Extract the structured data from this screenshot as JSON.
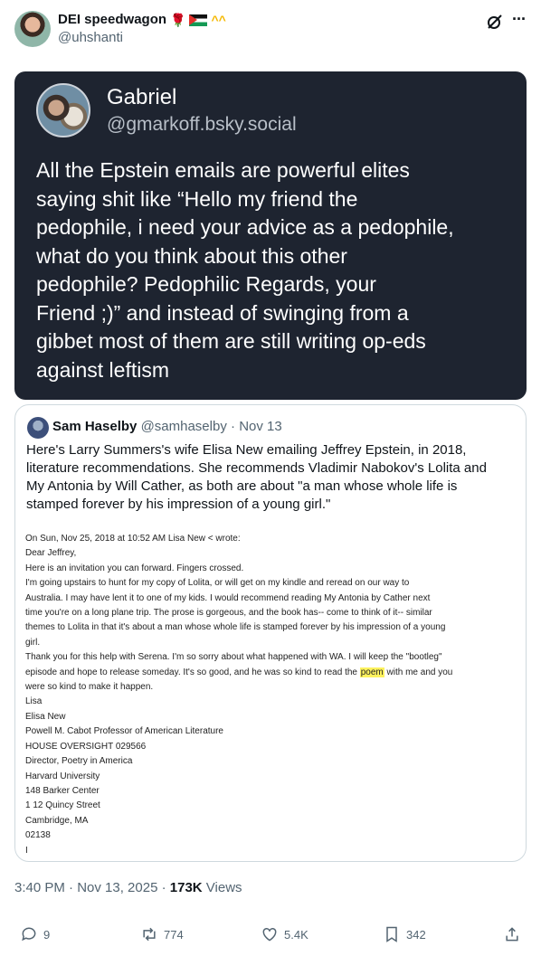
{
  "tweet": {
    "author_name": "DEI speedwagon",
    "author_handle": "@uhshanti"
  },
  "image_post": {
    "name": "Gabriel",
    "handle": "@gmarkoff.bsky.social",
    "lines": [
      "All the Epstein emails are powerful elites",
      "saying shit like “Hello my friend the",
      "pedophile, i need your advice as a pedophile,",
      "what do you think about this other",
      "pedophile? Pedophilic Regards, your",
      "Friend ;)” and instead of swinging from a",
      "gibbet most of them are still writing op-eds",
      "against leftism"
    ]
  },
  "quote": {
    "name": "Sam Haselby",
    "handle": "@samhaselby",
    "sep": " · ",
    "date": "Nov 13",
    "lines": [
      "Here's Larry Summers's wife Elisa New emailing Jeffrey Epstein, in 2018,",
      "literature recommendations. She recommends Vladimir Nabokov's Lolita and",
      "My Antonia by Will Cather, as both are about \"a man whose whole life is",
      "stamped forever by his impression of a young  girl.\""
    ]
  },
  "email": {
    "lines_top": [
      "On Sun, Nov 25, 2018 at 10:52 AM Lisa New < wrote:",
      "Dear Jeffrey,",
      "Here is an invitation you can forward. Fingers crossed.",
      "I'm going upstairs to hunt for my copy of Lolita, or will get on my kindle and reread on our way to",
      "Australia. I may have lent it to one of my kids. I would recommend reading My Antonia by Cather next",
      "time you're on a long plane trip. The prose is gorgeous, and the book has-- come to think of it-- similar",
      "themes to Lolita in that it's about a man whose whole life is stamped forever by his impression of a young",
      "girl.",
      "Thank you for this help with Serena. I'm so sorry about what happened with WA. I will keep the \"bootleg\""
    ],
    "hl_line_before": "episode and hope to release someday. It's so good, and he was so kind to read the ",
    "hl_word": "poem",
    "hl_line_after": " with me and you",
    "lines_bottom": [
      "were so kind to make it happen.",
      "Lisa",
      "Elisa New",
      "Powell M. Cabot Professor of American Literature",
      "HOUSE OVERSIGHT 029566",
      "Director, Poetry in America",
      "Harvard University",
      "148 Barker Center",
      "1 12 Quincy Street",
      "Cambridge, MA",
      "02138",
      "I"
    ]
  },
  "footer": {
    "time": "3:40 PM · Nov 13, 2025 · ",
    "views_count": "173K",
    "views_label": " Views"
  },
  "actions": {
    "replies": "9",
    "reposts": "774",
    "likes": "5.4K",
    "bookmarks": "342"
  },
  "icons": {
    "reply": "reply-icon",
    "repost": "repost-icon",
    "like": "heart-icon",
    "bookmark": "bookmark-icon",
    "share": "share-icon",
    "grok": "grok-icon",
    "more": "more-icon"
  }
}
